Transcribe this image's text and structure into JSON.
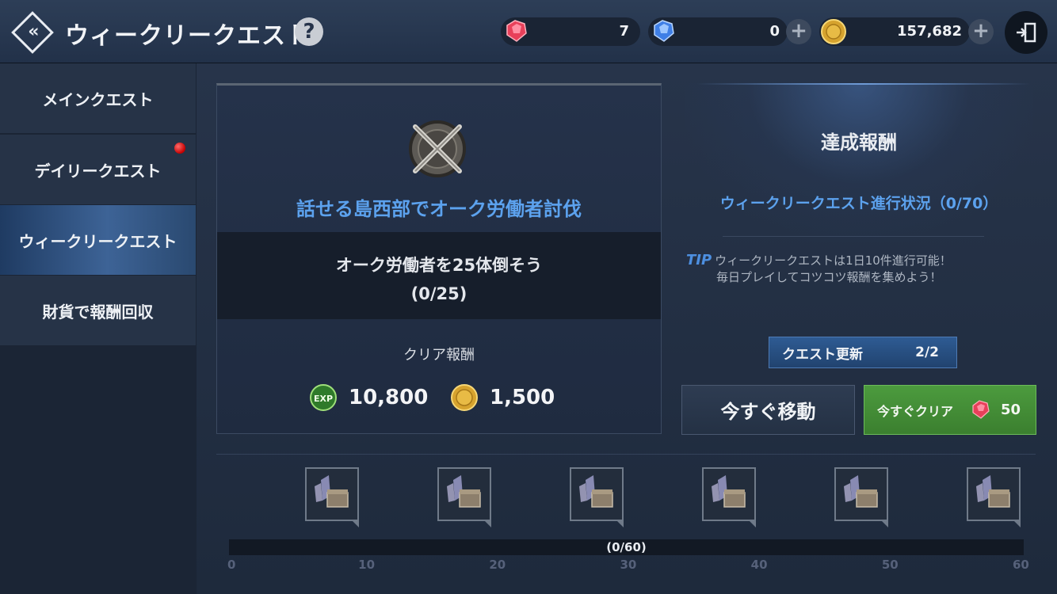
{
  "header": {
    "title": "ウィークリークエスト",
    "help_label": "?",
    "currencies": [
      {
        "name": "red-gem",
        "value": "7"
      },
      {
        "name": "blue-gem",
        "value": "0"
      },
      {
        "name": "gold-coin",
        "value": "157,682"
      }
    ],
    "plus_label": "+"
  },
  "sidebar": {
    "items": [
      {
        "label": "メインクエスト",
        "active": false,
        "notify": false
      },
      {
        "label": "デイリークエスト",
        "active": false,
        "notify": true
      },
      {
        "label": "ウィークリークエスト",
        "active": true,
        "notify": false
      },
      {
        "label": "財貨で報酬回収",
        "active": false,
        "notify": false
      }
    ]
  },
  "quest": {
    "title": "話せる島西部でオーク労働者討伐",
    "goal": "オーク労働者を25体倒そう",
    "goal_progress": "(0/25)",
    "reward_label": "クリア報酬",
    "exp_icon_label": "EXP",
    "exp_value": "10,800",
    "gold_value": "1,500"
  },
  "achievement": {
    "title": "達成報酬",
    "status": "ウィークリークエスト進行状況（0/70）",
    "tip_label": "TIP",
    "tip_line1": "ウィークリークエストは1日10件進行可能！",
    "tip_line2": "毎日プレイしてコツコツ報酬を集めよう！"
  },
  "actions": {
    "refresh_label": "クエスト更新",
    "refresh_count": "2/2",
    "move_label": "今すぐ移動",
    "clear_label": "今すぐクリア",
    "clear_cost": "50"
  },
  "progress": {
    "text": "(0/60)",
    "current": 0,
    "max": 60,
    "ticks": [
      "0",
      "10",
      "20",
      "30",
      "40",
      "50",
      "60"
    ]
  },
  "colors": {
    "accent_blue": "#5ca2ee",
    "clear_green": "#4c9b3e",
    "notify_red": "#c40000"
  }
}
